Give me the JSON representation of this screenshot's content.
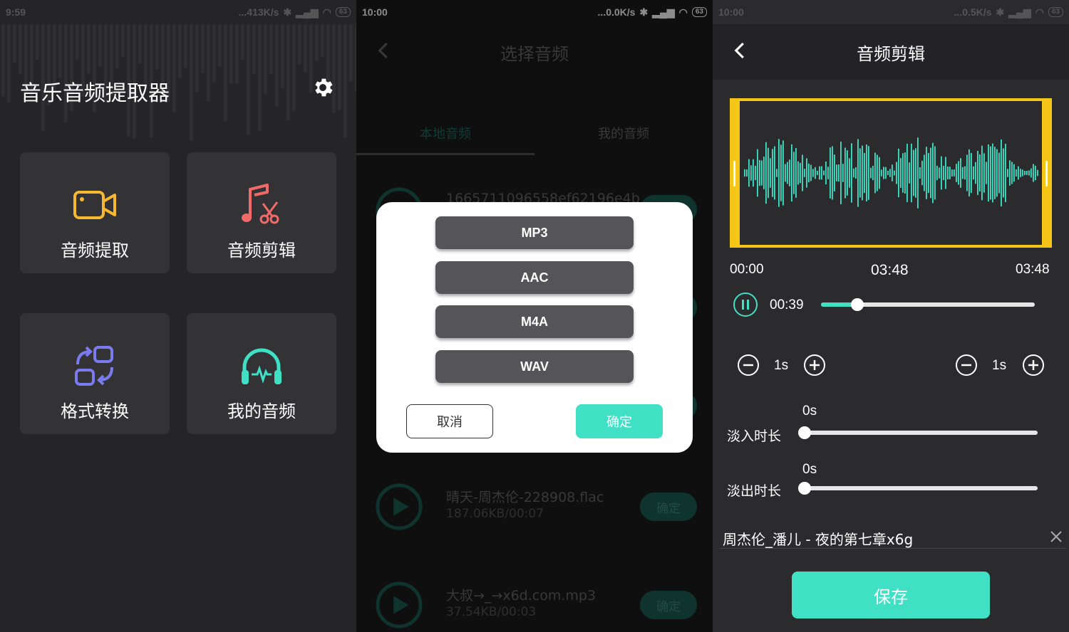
{
  "colors": {
    "accent": "#40e0c5",
    "dark_bg": "#252528",
    "tile_bg": "#333336",
    "selection": "#f5c518",
    "camera": "#f5b82e",
    "music": "#f06a6a",
    "convert": "#7b7bf0",
    "myaudio": "#40e0c5"
  },
  "screen1": {
    "status": {
      "time": "9:59",
      "speed": "...413K/s",
      "battery": "63"
    },
    "title": "音乐音频提取器",
    "settings_icon": "gear-icon",
    "tiles": [
      {
        "label": "音频提取",
        "icon": "video-camera-icon"
      },
      {
        "label": "音频剪辑",
        "icon": "music-scissors-icon"
      },
      {
        "label": "格式转换",
        "icon": "convert-icon"
      },
      {
        "label": "我的音频",
        "icon": "headphones-icon"
      }
    ]
  },
  "screen2": {
    "status": {
      "time": "10:00",
      "speed": "...0.0K/s",
      "battery": "63"
    },
    "title": "选择音频",
    "tabs": [
      "本地音频",
      "我的音频"
    ],
    "partial_row": {
      "name": "1665711096558ef62196e4b"
    },
    "rows": [
      {
        "name": "晴天-周杰伦-228908.flac",
        "meta": "187.06KB/00:07",
        "action": "确定"
      },
      {
        "name": "大叔→_→x6d.com.mp3",
        "meta": "37.54KB/00:03",
        "action": "确定"
      }
    ],
    "dialog": {
      "formats": [
        "MP3",
        "AAC",
        "M4A",
        "WAV"
      ],
      "cancel": "取消",
      "confirm": "确定"
    }
  },
  "screen3": {
    "status": {
      "time": "10:00",
      "speed": "...0.5K/s",
      "battery": "63"
    },
    "title": "音频剪辑",
    "time_start": "00:00",
    "time_mid": "03:48",
    "time_end": "03:48",
    "current_time": "00:39",
    "playback_progress": 0.17,
    "step_left": "1s",
    "step_right": "1s",
    "fade_in": {
      "label": "淡入时长",
      "value": "0s",
      "progress": 0
    },
    "fade_out": {
      "label": "淡出时长",
      "value": "0s",
      "progress": 0
    },
    "filename": "周杰伦_潘儿 - 夜的第七章x6g",
    "save": "保存"
  }
}
